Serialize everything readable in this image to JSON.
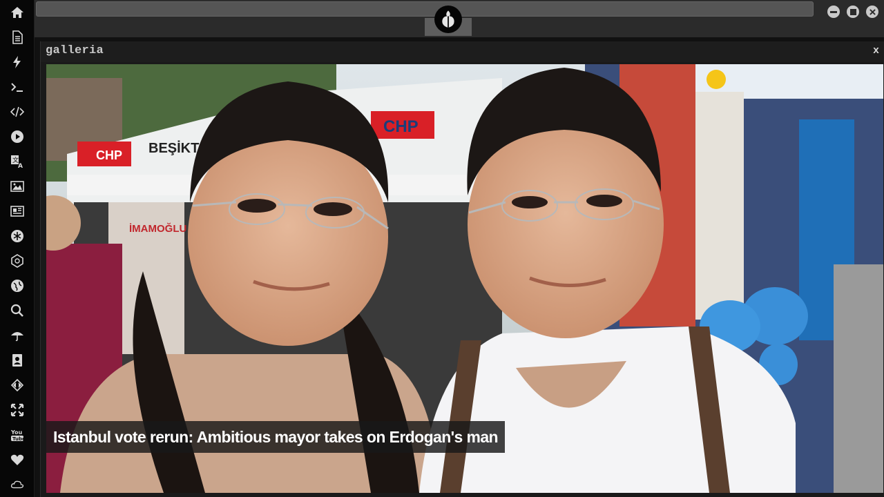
{
  "sidebar": {
    "items": [
      {
        "icon": "home-icon"
      },
      {
        "icon": "document-icon"
      },
      {
        "icon": "lightning-icon"
      },
      {
        "icon": "terminal-icon"
      },
      {
        "icon": "code-icon"
      },
      {
        "icon": "play-icon"
      },
      {
        "icon": "translate-icon"
      },
      {
        "icon": "image-icon"
      },
      {
        "icon": "newspaper-icon"
      },
      {
        "icon": "rebel-emblem-icon"
      },
      {
        "icon": "empire-emblem-icon"
      },
      {
        "icon": "globe-icon"
      },
      {
        "icon": "search-icon"
      },
      {
        "icon": "umbrella-icon"
      },
      {
        "icon": "contacts-icon"
      },
      {
        "icon": "dev-icon"
      },
      {
        "icon": "expand-icon"
      },
      {
        "icon": "youtube-icon"
      },
      {
        "icon": "heart-icon"
      },
      {
        "icon": "cloud-icon"
      }
    ]
  },
  "window": {
    "controls": [
      "minimize",
      "maximize",
      "close"
    ],
    "logo": "rebel-alliance-logo"
  },
  "gallery": {
    "title": "galleria",
    "close_label": "x",
    "caption": "Istanbul vote rerun: Ambitious mayor takes on Erdogan's man",
    "photo_signage": {
      "tent_left": "BEŞİKTAŞ",
      "brand": "CHP",
      "poster": "İMAMOĞLU"
    }
  },
  "colors": {
    "sidebar_bg": "#070707",
    "topbar_bg": "#2b2b2b",
    "panel_bg": "#1a1a1a",
    "caption_bg": "#181818",
    "chp_red": "#d92027",
    "party_blue": "#1f6fb7"
  }
}
